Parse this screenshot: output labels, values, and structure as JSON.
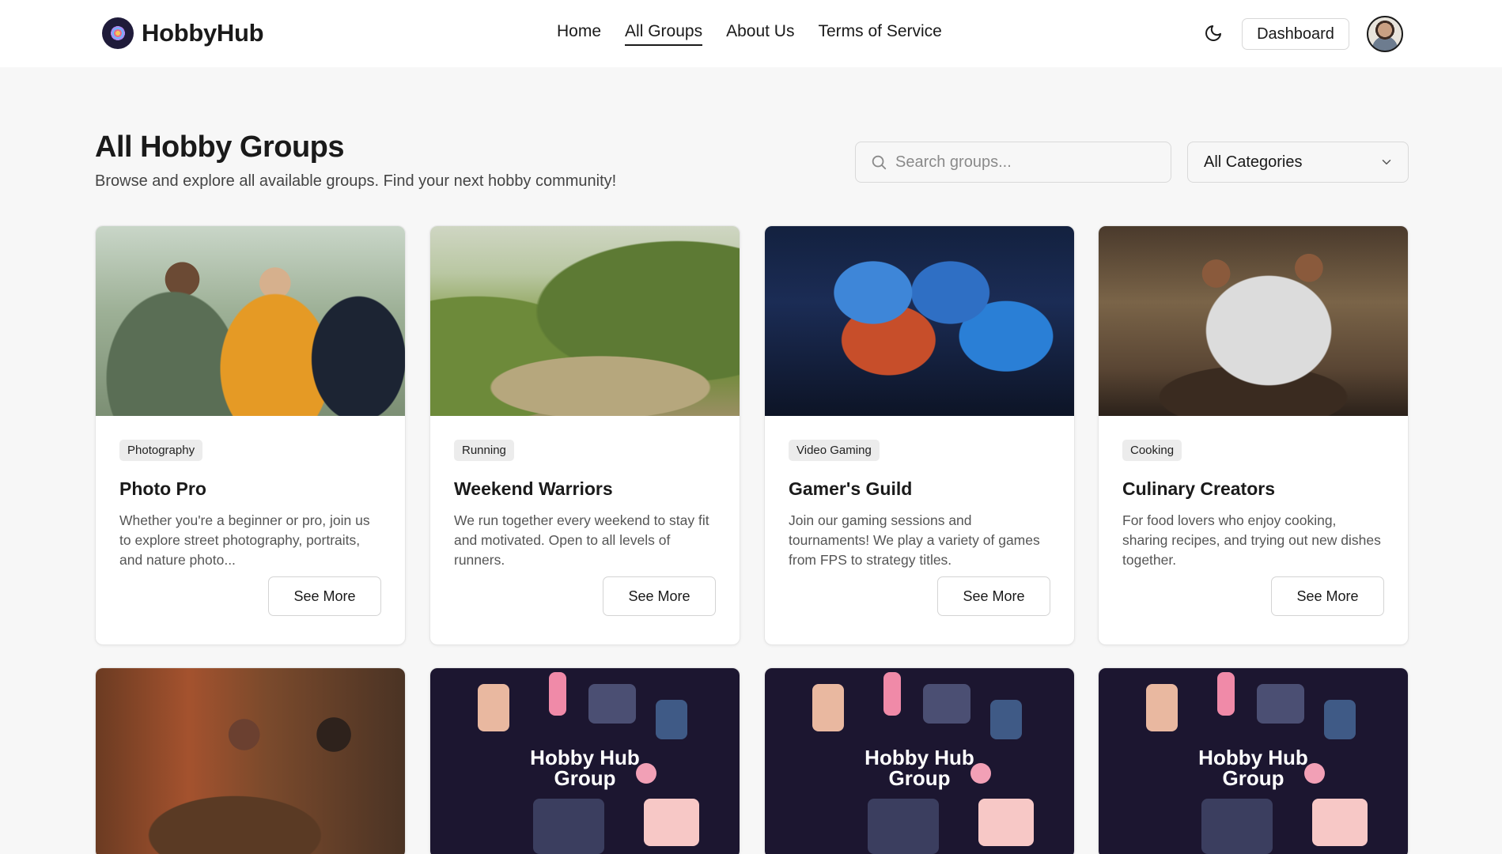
{
  "header": {
    "logo_text": "HobbyHub",
    "nav": [
      "Home",
      "All Groups",
      "About Us",
      "Terms of Service"
    ],
    "active_nav": "All Groups",
    "dashboard_label": "Dashboard"
  },
  "page": {
    "title": "All Hobby Groups",
    "subtitle": "Browse and explore all available groups. Find your next hobby community!",
    "search_placeholder": "Search groups...",
    "category_selected": "All Categories"
  },
  "cards": [
    {
      "category": "Photography",
      "title": "Photo Pro",
      "description": "Whether you're a beginner or pro, join us to explore street photography, portraits, and nature photo...",
      "button": "See More"
    },
    {
      "category": "Running",
      "title": "Weekend Warriors",
      "description": "We run together every weekend to stay fit and motivated. Open to all levels of runners.",
      "button": "See More"
    },
    {
      "category": "Video Gaming",
      "title": "Gamer's Guild",
      "description": "Join our gaming sessions and tournaments! We play a variety of games from FPS to strategy titles.",
      "button": "See More"
    },
    {
      "category": "Cooking",
      "title": "Culinary Creators",
      "description": "For food lovers who enjoy cooking, sharing recipes, and trying out new dishes together.",
      "button": "See More"
    }
  ],
  "placeholder_image_text": [
    "Hobby Hub",
    "Group"
  ],
  "colors": {
    "page_bg": "#f7f7f7",
    "header_bg": "#ffffff",
    "text": "#1a1a1a",
    "badge_bg": "#ececec",
    "placeholder_bg": "#1c1630"
  }
}
